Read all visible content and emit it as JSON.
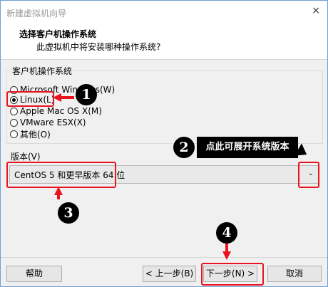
{
  "window": {
    "title": "新建虚拟机向导",
    "close": "×"
  },
  "header": {
    "title": "选择客户机操作系统",
    "subtitle": "此虚拟机中将安装哪种操作系统?"
  },
  "os_group": {
    "label": "客户机操作系统",
    "options": [
      {
        "label": "Microsoft Windows(W)",
        "checked": false
      },
      {
        "label": "Linux(L)",
        "checked": true
      },
      {
        "label": "Apple Mac OS X(M)",
        "checked": false
      },
      {
        "label": "VMware ESX(X)",
        "checked": false
      },
      {
        "label": "其他(O)",
        "checked": false
      }
    ]
  },
  "version": {
    "label": "版本(V)",
    "selected": "CentOS 5 和更早版本 64 位"
  },
  "buttons": {
    "help": "帮助",
    "back": "< 上一步(B)",
    "next": "下一步(N) >",
    "cancel": "取消"
  },
  "annotations": {
    "badge1": "1",
    "badge2": "2",
    "badge3": "3",
    "badge4": "4",
    "callout_text": "点此可展开系统版本",
    "accent_color": "#e8131f"
  }
}
